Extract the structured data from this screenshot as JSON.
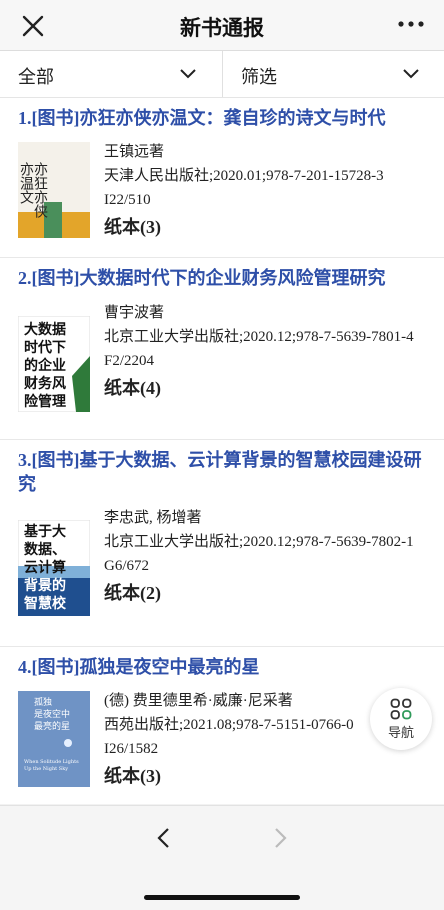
{
  "header": {
    "title": "新书通报"
  },
  "filters": {
    "all_label": "全部",
    "filter_label": "筛选"
  },
  "books": [
    {
      "title": "1.[图书]亦狂亦侠亦温文：龚自珍的诗文与时代",
      "author": "王镇远著",
      "publisher": "天津人民出版社;2020.01;978-7-201-15728-3",
      "call_no": "I22/510",
      "paper": "纸本(3)",
      "cover_text": [
        "亦狂亦侠",
        "亦温文"
      ]
    },
    {
      "title": "2.[图书]大数据时代下的企业财务风险管理研究",
      "author": "曹宇波著",
      "publisher": "北京工业大学出版社;2020.12;978-7-5639-7801-4",
      "call_no": "F2/2204",
      "paper": "纸本(4)",
      "cover_text": [
        "大数据",
        "时代下",
        "的企业",
        "财务风",
        "险管理"
      ]
    },
    {
      "title": "3.[图书]基于大数据、云计算背景的智慧校园建设研究",
      "author": "李忠武, 杨增著",
      "publisher": "北京工业大学出版社;2020.12;978-7-5639-7802-1",
      "call_no": "G6/672",
      "paper": "纸本(2)",
      "cover_text": [
        "基于大",
        "数据、",
        "云计算",
        "背景的",
        "智慧校"
      ]
    },
    {
      "title": "4.[图书]孤独是夜空中最亮的星",
      "author": "(德) 费里德里希·威廉·尼采著",
      "publisher": "西苑出版社;2021.08;978-7-5151-0766-0",
      "call_no": "I26/1582",
      "paper": "纸本(3)",
      "cover_text": [
        "孤独",
        "是夜空中",
        "最亮的星",
        "When Solitude Lights",
        "Up the Night Sky"
      ]
    }
  ],
  "float_nav": {
    "label": "导航",
    "icon": "grid-icon"
  },
  "colors": {
    "title_blue": "#2e4fa8",
    "cover2_green": "#2f7a3a",
    "cover3_blue": "#1f4f8f",
    "cover4_blue": "#6f93c5"
  }
}
